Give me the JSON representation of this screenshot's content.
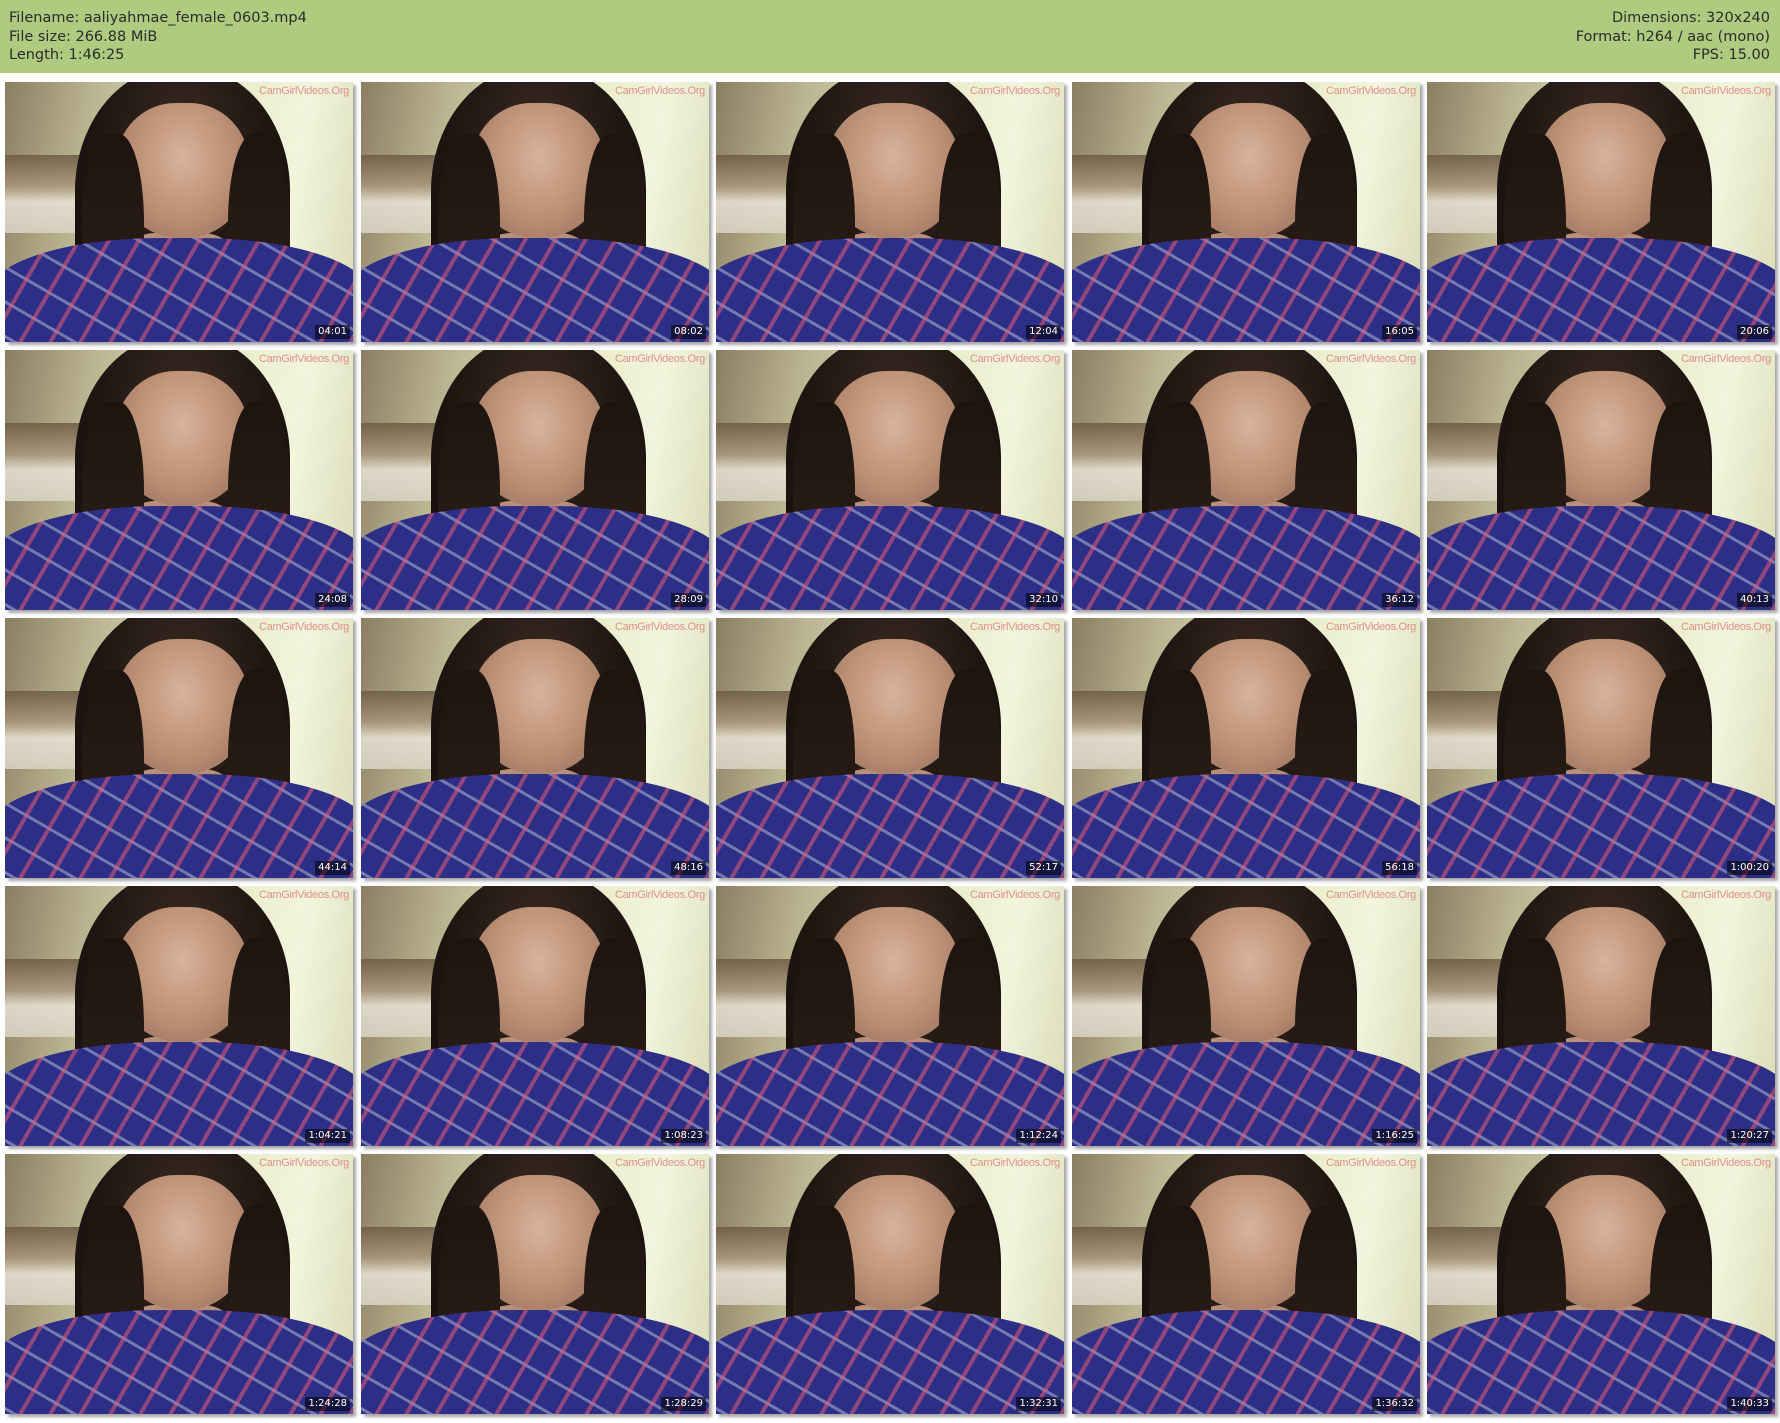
{
  "header": {
    "filename": "Filename: aaliyahmae_female_0603.mp4",
    "file_size": "File size: 266.88 MiB",
    "length": "Length: 1:46:25",
    "dimensions": "Dimensions: 320x240",
    "format": "Format: h264 / aac (mono)",
    "fps": "FPS: 15.00"
  },
  "watermark": "CamGirlVideos.Org",
  "thumbnails": [
    {
      "time": "04:01"
    },
    {
      "time": "08:02"
    },
    {
      "time": "12:04"
    },
    {
      "time": "16:05"
    },
    {
      "time": "20:06"
    },
    {
      "time": "24:08"
    },
    {
      "time": "28:09"
    },
    {
      "time": "32:10"
    },
    {
      "time": "36:12"
    },
    {
      "time": "40:13"
    },
    {
      "time": "44:14"
    },
    {
      "time": "48:16"
    },
    {
      "time": "52:17"
    },
    {
      "time": "56:18"
    },
    {
      "time": "1:00:20"
    },
    {
      "time": "1:04:21"
    },
    {
      "time": "1:08:23"
    },
    {
      "time": "1:12:24"
    },
    {
      "time": "1:16:25"
    },
    {
      "time": "1:20:27"
    },
    {
      "time": "1:24:28"
    },
    {
      "time": "1:28:29"
    },
    {
      "time": "1:32:31"
    },
    {
      "time": "1:36:32"
    },
    {
      "time": "1:40:33"
    }
  ]
}
